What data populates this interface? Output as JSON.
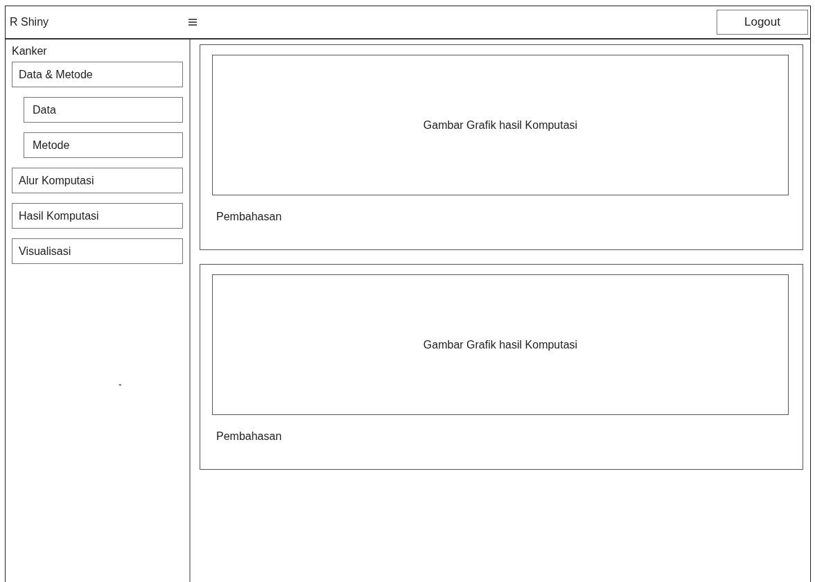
{
  "header": {
    "brand": "R Shiny",
    "logout": "Logout"
  },
  "sidebar": {
    "title": "Kanker",
    "items": [
      {
        "label": "Data & Metode",
        "children": [
          {
            "label": "Data"
          },
          {
            "label": "Metode"
          }
        ]
      },
      {
        "label": "Alur Komputasi"
      },
      {
        "label": "Hasil Komputasi"
      },
      {
        "label": "Visualisasi"
      }
    ],
    "mark": "-"
  },
  "cards": [
    {
      "chart_label": "Gambar Grafik hasil Komputasi",
      "caption": "Pembahasan"
    },
    {
      "chart_label": "Gambar Grafik hasil Komputasi",
      "caption": "Pembahasan"
    }
  ]
}
